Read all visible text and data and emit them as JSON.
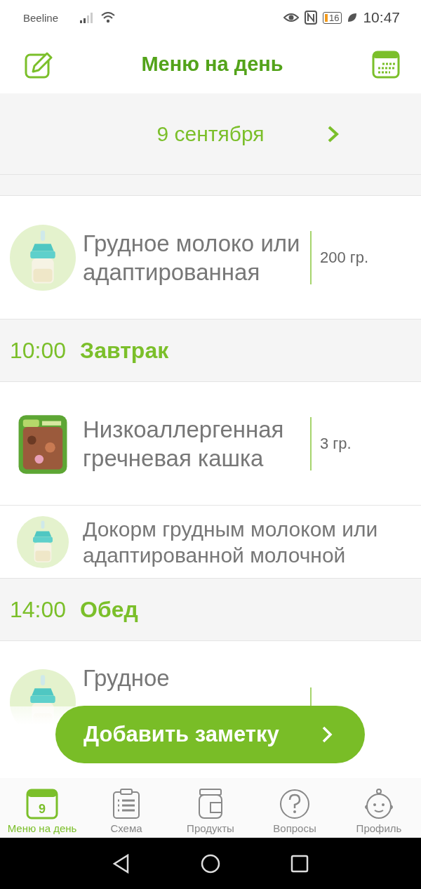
{
  "status_bar": {
    "carrier": "Beeline",
    "battery": "16",
    "time": "10:47"
  },
  "header": {
    "title": "Меню на день"
  },
  "date_bar": {
    "date": "9 сентября"
  },
  "feed": [
    {
      "kind": "partial"
    },
    {
      "kind": "food",
      "name": "Грудное молоко или адаптированная",
      "amount": "200 гр."
    },
    {
      "kind": "section",
      "time": "10:00",
      "title": "Завтрак"
    },
    {
      "kind": "food",
      "name": "Низкоаллергенная гречневая кашка",
      "amount": "3 гр."
    },
    {
      "kind": "note",
      "name": "Докорм грудным молоком или адаптированной молочной"
    },
    {
      "kind": "section",
      "time": "14:00",
      "title": "Обед"
    },
    {
      "kind": "food",
      "name": "Грудное"
    }
  ],
  "add_button": {
    "label": "Добавить заметку"
  },
  "tab_bar": [
    {
      "kind": "calendar",
      "label": "Меню на день",
      "badge": "9",
      "selected": true
    },
    {
      "kind": "list",
      "label": "Схема",
      "selected": false
    },
    {
      "kind": "jar",
      "label": "Продукты",
      "selected": false
    },
    {
      "kind": "question",
      "label": "Вопросы",
      "selected": false
    },
    {
      "kind": "baby",
      "label": "Профиль",
      "selected": false
    }
  ]
}
